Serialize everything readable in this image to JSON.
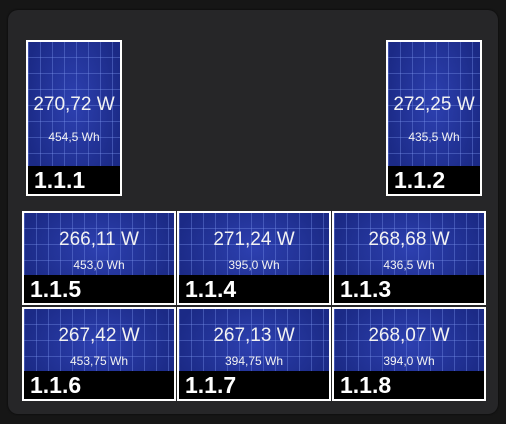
{
  "colors": {
    "card_background": "#262628",
    "panel_cell_blue": "#1f2f93",
    "panel_border": "#ffffff",
    "label_bar": "#000000",
    "text": "#f2f2f2"
  },
  "panels": [
    {
      "id": "1.1.1",
      "power": "270,72 W",
      "energy": "454,5 Wh"
    },
    {
      "id": "1.1.2",
      "power": "272,25 W",
      "energy": "435,5 Wh"
    },
    {
      "id": "1.1.5",
      "power": "266,11 W",
      "energy": "453,0 Wh"
    },
    {
      "id": "1.1.4",
      "power": "271,24 W",
      "energy": "395,0 Wh"
    },
    {
      "id": "1.1.3",
      "power": "268,68 W",
      "energy": "436,5 Wh"
    },
    {
      "id": "1.1.6",
      "power": "267,42 W",
      "energy": "453,75 Wh"
    },
    {
      "id": "1.1.7",
      "power": "267,13 W",
      "energy": "394,75 Wh"
    },
    {
      "id": "1.1.8",
      "power": "268,07 W",
      "energy": "394,0 Wh"
    }
  ]
}
